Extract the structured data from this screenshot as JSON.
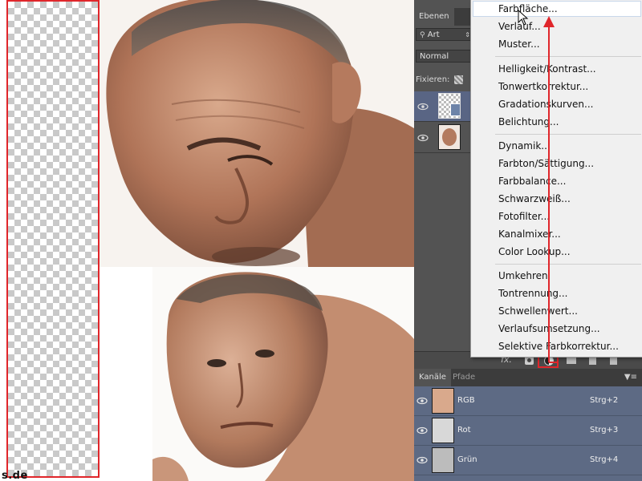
{
  "canvas": {
    "caption": "s.de"
  },
  "layers_panel": {
    "tab_label": "Ebenen",
    "filter_value": "Art",
    "blend_mode": "Normal",
    "lock_label": "Fixieren:",
    "icons": [
      "eye-icon",
      "eye-icon",
      "fx-icon",
      "adjustment-layer-icon"
    ]
  },
  "channels_panel": {
    "tabs": [
      "Kanäle",
      "Pfade"
    ],
    "rows": [
      {
        "name": "RGB",
        "shortcut": "Strg+2"
      },
      {
        "name": "Rot",
        "shortcut": "Strg+3"
      },
      {
        "name": "Grün",
        "shortcut": "Strg+4"
      }
    ]
  },
  "adjustment_menu": {
    "groups": [
      [
        "Farbfläche...",
        "Verlauf...",
        "Muster..."
      ],
      [
        "Helligkeit/Kontrast...",
        "Tonwertkorrektur...",
        "Gradationskurven...",
        "Belichtung..."
      ],
      [
        "Dynamik...",
        "Farbton/Sättigung...",
        "Farbbalance...",
        "Schwarzweiß...",
        "Fotofilter...",
        "Kanalmixer...",
        "Color Lookup..."
      ],
      [
        "Umkehren",
        "Tontrennung...",
        "Schwellenwert...",
        "Verlaufsumsetzung...",
        "Selektive Farbkorrektur..."
      ]
    ],
    "highlighted": "Farbfläche..."
  },
  "colors": {
    "highlight_red": "#e0262b",
    "panel_bg": "#535353",
    "channel_row": "#5d6a84",
    "menu_bg": "#f0f0f0"
  }
}
